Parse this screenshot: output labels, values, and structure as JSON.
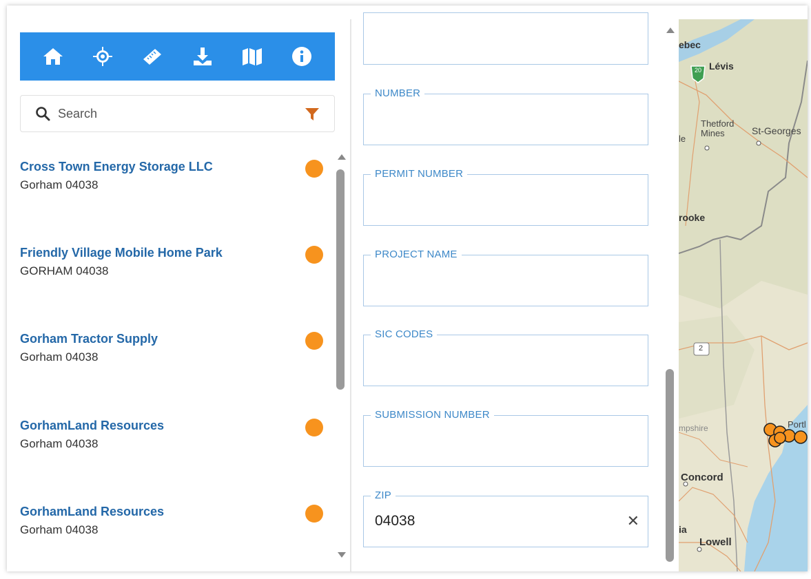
{
  "toolbar": {
    "tools": [
      {
        "icon": "home-icon"
      },
      {
        "icon": "locate-icon"
      },
      {
        "icon": "measure-icon"
      },
      {
        "icon": "download-icon"
      },
      {
        "icon": "map-icon"
      },
      {
        "icon": "info-icon"
      }
    ]
  },
  "search": {
    "placeholder": "Search",
    "icon": "search-icon",
    "filter_icon": "filter-icon",
    "filter_color": "#d2691e"
  },
  "results": [
    {
      "name": "Cross Town Energy Storage LLC",
      "address": "Gorham 04038"
    },
    {
      "name": "Friendly Village Mobile Home Park",
      "address": "GORHAM 04038"
    },
    {
      "name": "Gorham Tractor Supply",
      "address": "Gorham 04038"
    },
    {
      "name": "GorhamLand Resources",
      "address": "Gorham 04038"
    },
    {
      "name": "GorhamLand Resources",
      "address": "Gorham 04038"
    }
  ],
  "marker_color": "#f7931e",
  "accent_color": "#2b8fe8",
  "form": {
    "fields": [
      {
        "label": "",
        "value": ""
      },
      {
        "label": "NUMBER",
        "value": ""
      },
      {
        "label": "PERMIT NUMBER",
        "value": ""
      },
      {
        "label": "PROJECT NAME",
        "value": ""
      },
      {
        "label": "SIC CODES",
        "value": ""
      },
      {
        "label": "SUBMISSION NUMBER",
        "value": ""
      },
      {
        "label": "ZIP",
        "value": "04038"
      }
    ],
    "clear_symbol": "✕"
  },
  "map": {
    "labels": {
      "quebec": "ebec",
      "levis": "Lévis",
      "thetford": "Thetford",
      "mines": "Mines",
      "le": "le",
      "stgeorges": "St-Georges",
      "rooke": "rooke",
      "route2": "2",
      "route20": "20",
      "mpshire": "mpshire",
      "portland": "Portl",
      "concord": "Concord",
      "ia": "ia",
      "lowell": "Lowell"
    }
  }
}
